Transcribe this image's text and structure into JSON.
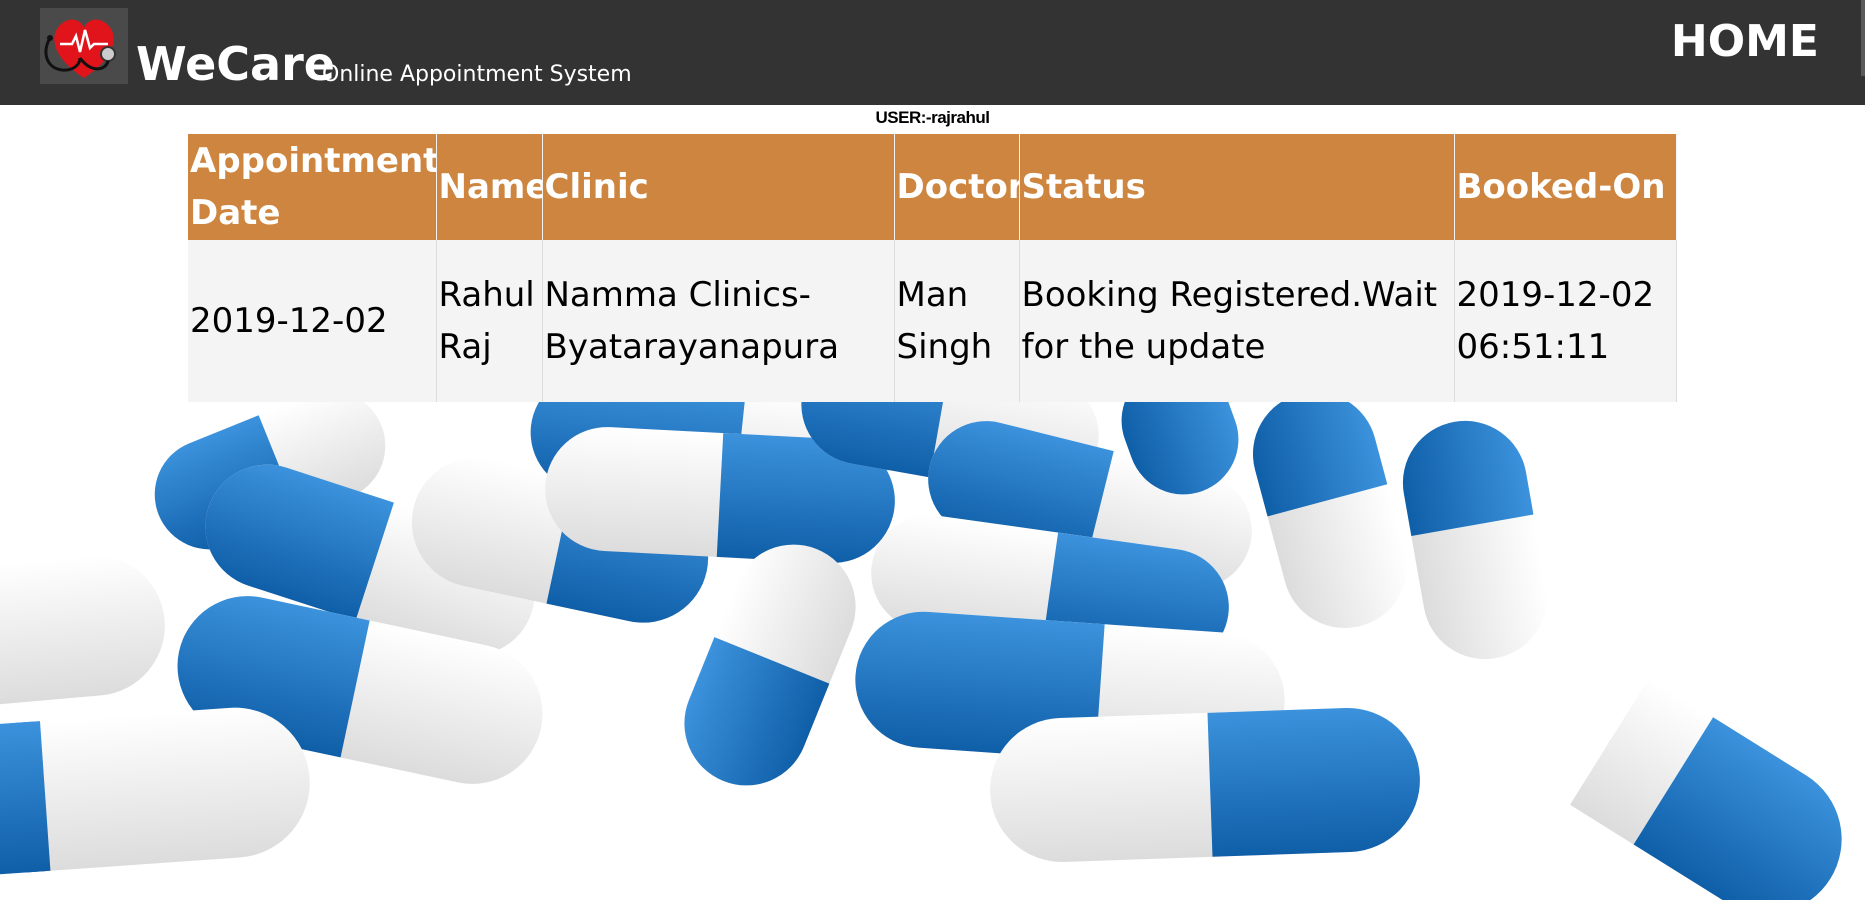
{
  "header": {
    "brand": "WeCare",
    "tagline": "Online Appointment System",
    "home_label": "HOME",
    "background": "#333333"
  },
  "user_line": "USER:-rajrahul",
  "table": {
    "header_color": "#cd853f",
    "columns": [
      "Appointment-Date",
      "Name",
      "Clinic",
      "Doctor",
      "Status",
      "Booked-On"
    ],
    "rows": [
      [
        "2019-12-02",
        "Rahul Raj",
        "Namma Clinics-Byatarayanapura",
        "Man Singh",
        "Booking Registered.Wait for the update",
        "2019-12-02 06:51:11"
      ]
    ]
  },
  "icons": {
    "logo": "heart-stethoscope-icon"
  },
  "colors": {
    "capsule_blue": "#1e78c8",
    "capsule_white": "#f2f2f2"
  }
}
